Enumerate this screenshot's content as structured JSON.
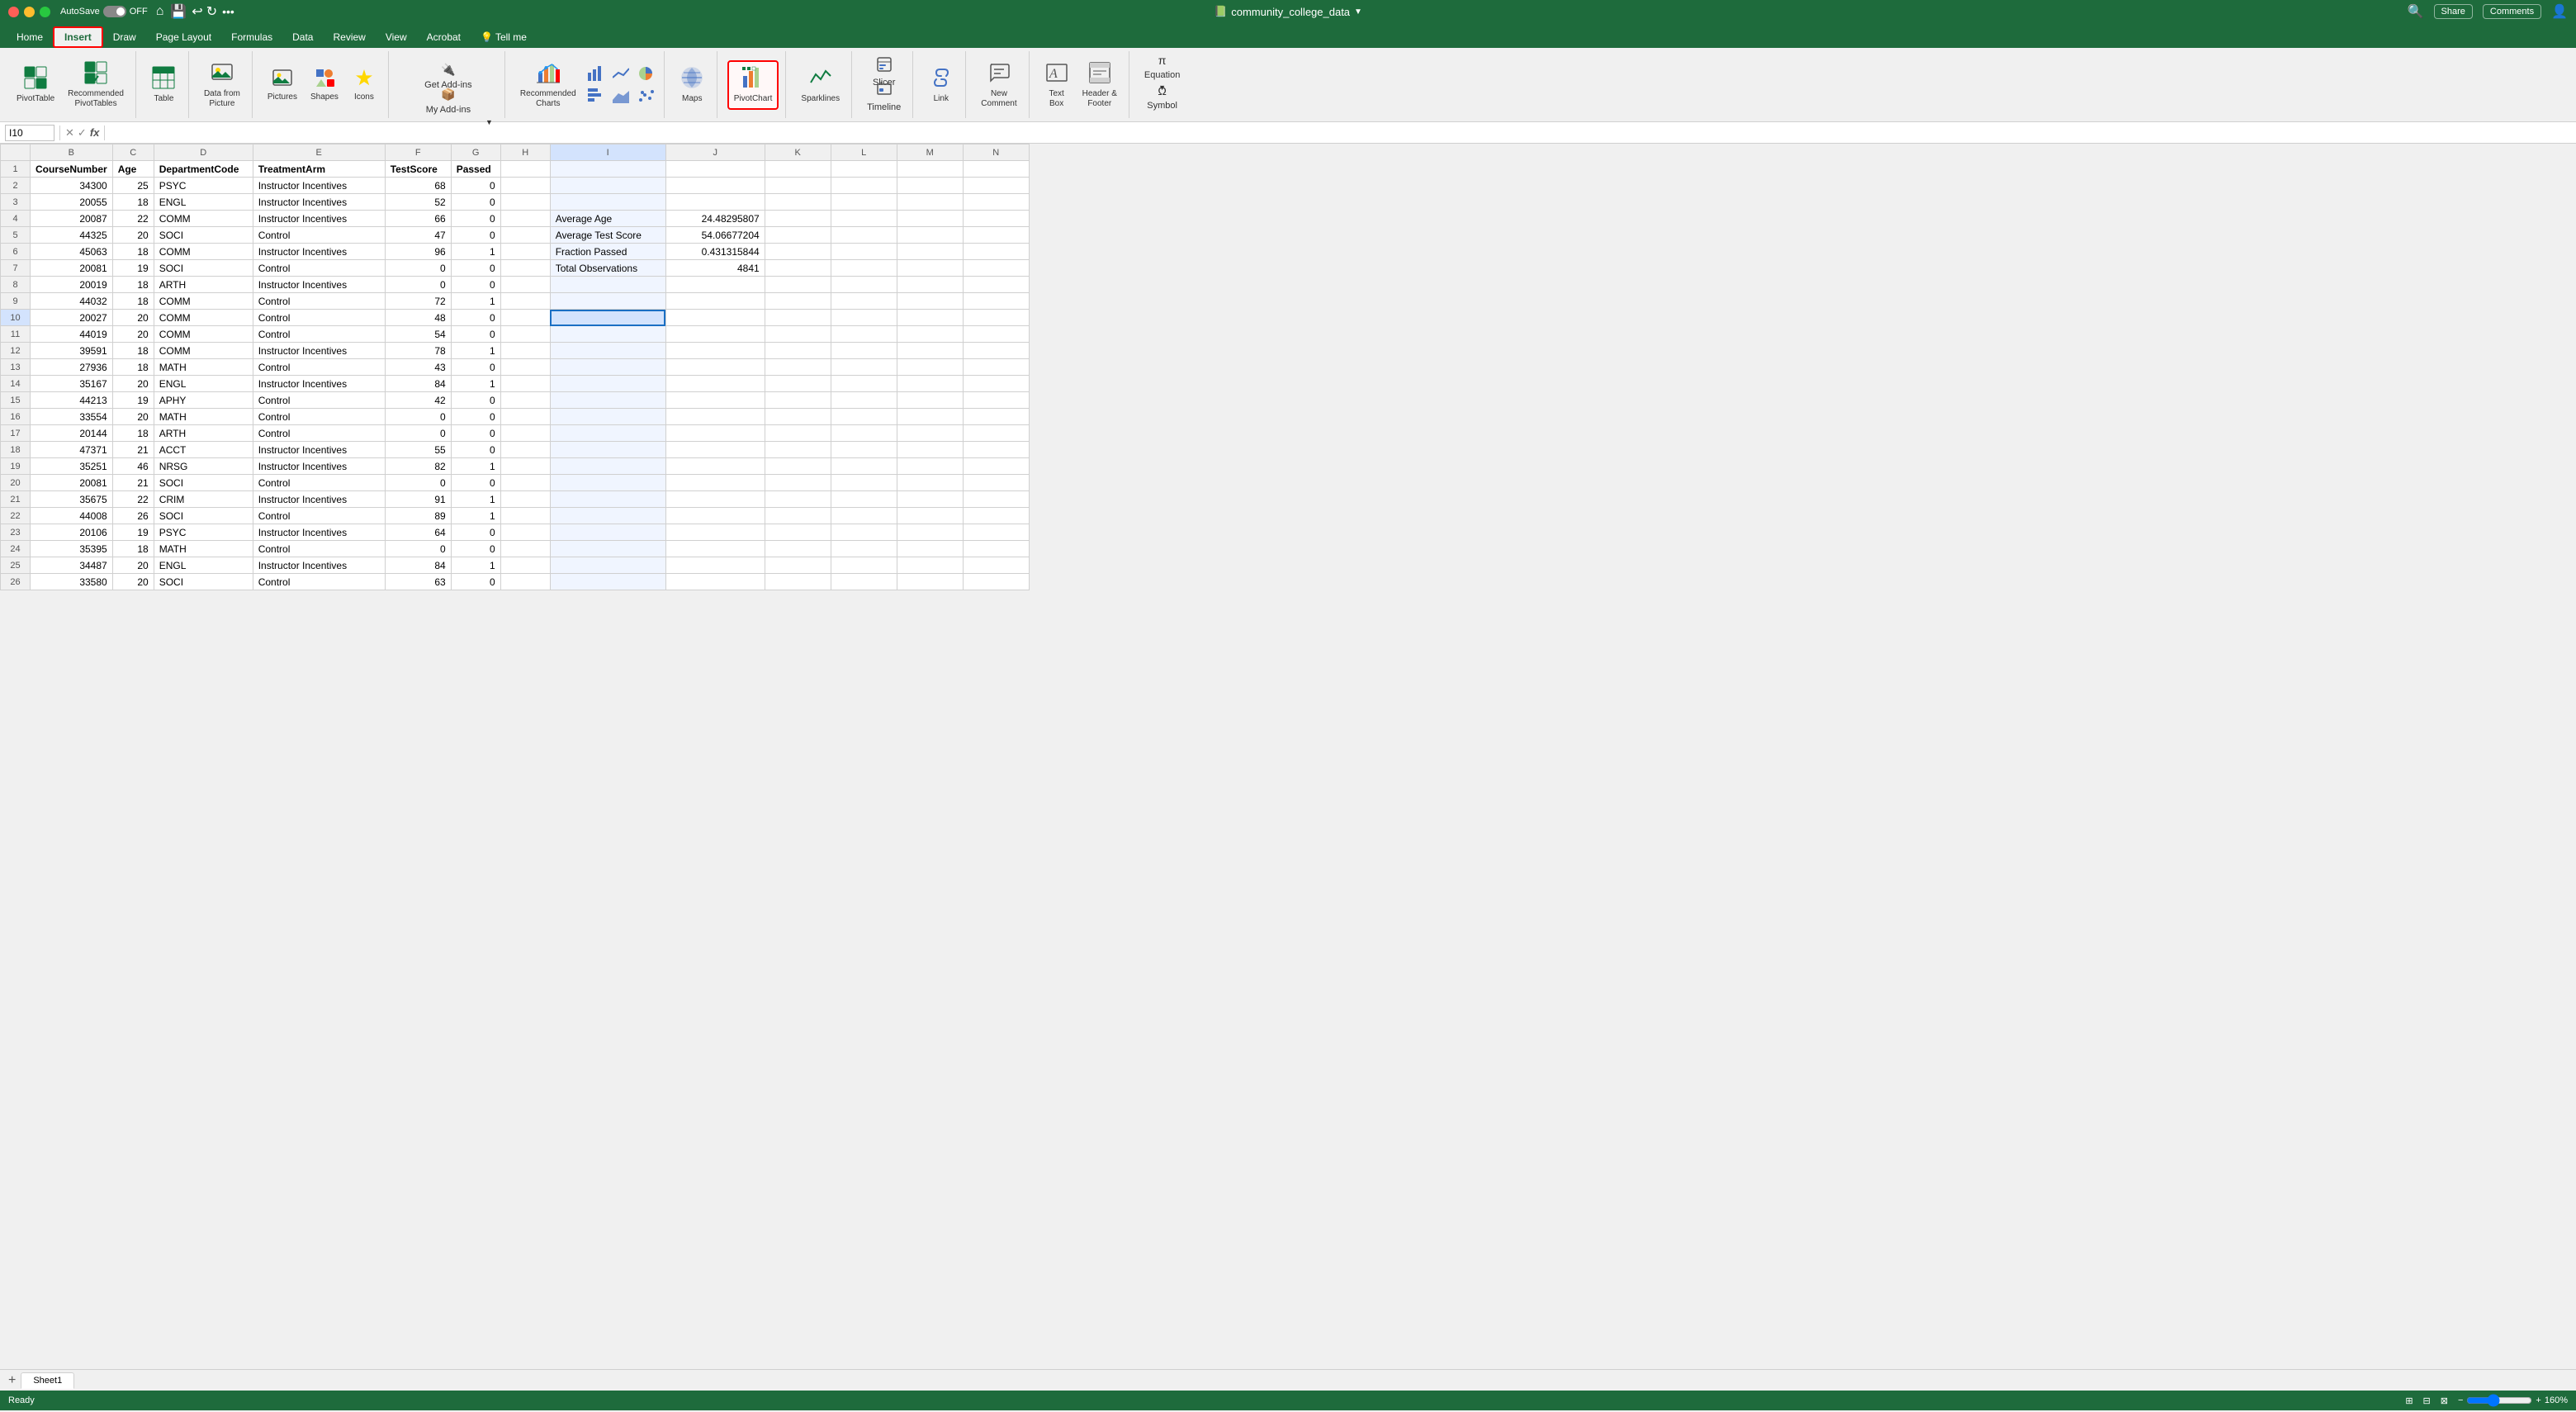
{
  "titleBar": {
    "filename": "community_college_data",
    "windowControls": [
      "close",
      "minimize",
      "maximize"
    ],
    "rightIcons": [
      "search",
      "share",
      "more"
    ]
  },
  "tabs": [
    {
      "label": "Home",
      "active": false
    },
    {
      "label": "Insert",
      "active": true
    },
    {
      "label": "Draw",
      "active": false
    },
    {
      "label": "Page Layout",
      "active": false
    },
    {
      "label": "Formulas",
      "active": false
    },
    {
      "label": "Data",
      "active": false
    },
    {
      "label": "Review",
      "active": false
    },
    {
      "label": "View",
      "active": false
    },
    {
      "label": "Acrobat",
      "active": false
    },
    {
      "label": "Tell me",
      "active": false
    }
  ],
  "ribbon": {
    "groups": [
      {
        "label": "",
        "items": [
          {
            "id": "pivot-table",
            "icon": "📊",
            "label": "PivotTable",
            "highlighted": false
          },
          {
            "id": "recommended-pivottables",
            "icon": "📋",
            "label": "Recommended\nPivotTables",
            "highlighted": false
          }
        ]
      },
      {
        "label": "",
        "items": [
          {
            "id": "table",
            "icon": "⊞",
            "label": "Table",
            "highlighted": false
          }
        ]
      },
      {
        "label": "",
        "items": [
          {
            "id": "data-from-picture",
            "icon": "🖼",
            "label": "Data from\nPicture",
            "highlighted": false
          }
        ]
      },
      {
        "label": "",
        "items": [
          {
            "id": "pictures",
            "icon": "🖼",
            "label": "Pictures",
            "highlighted": false
          },
          {
            "id": "shapes",
            "icon": "⬡",
            "label": "Shapes",
            "highlighted": false
          },
          {
            "id": "icons",
            "icon": "⭐",
            "label": "Icons",
            "highlighted": false
          }
        ]
      },
      {
        "label": "",
        "items": [
          {
            "id": "get-addins",
            "icon": "🔌",
            "label": "Get Add-ins",
            "highlighted": false
          },
          {
            "id": "my-addins",
            "icon": "📦",
            "label": "My Add-ins",
            "highlighted": false
          }
        ]
      },
      {
        "label": "",
        "items": [
          {
            "id": "recommended-charts",
            "icon": "📈",
            "label": "Recommended\nCharts",
            "highlighted": false
          },
          {
            "id": "insert-column-chart",
            "icon": "📊",
            "label": "",
            "highlighted": false
          },
          {
            "id": "insert-line-chart",
            "icon": "📉",
            "label": "",
            "highlighted": false
          },
          {
            "id": "insert-pie-chart",
            "icon": "🥧",
            "label": "",
            "highlighted": false
          },
          {
            "id": "insert-bar-chart",
            "icon": "▬",
            "label": "",
            "highlighted": false
          },
          {
            "id": "insert-area-chart",
            "icon": "△",
            "label": "",
            "highlighted": false
          },
          {
            "id": "insert-scatter",
            "icon": "⋯",
            "label": "",
            "highlighted": false
          },
          {
            "id": "insert-other-charts",
            "icon": "…",
            "label": "",
            "highlighted": false
          }
        ]
      },
      {
        "label": "",
        "items": [
          {
            "id": "maps",
            "icon": "🗺",
            "label": "Maps",
            "highlighted": false
          }
        ]
      },
      {
        "label": "",
        "items": [
          {
            "id": "pivot-chart",
            "icon": "📊",
            "label": "PivotChart",
            "highlighted": true
          }
        ]
      },
      {
        "label": "",
        "items": [
          {
            "id": "sparklines",
            "icon": "〰",
            "label": "Sparklines",
            "highlighted": false
          }
        ]
      },
      {
        "label": "",
        "items": [
          {
            "id": "slicer",
            "icon": "🔲",
            "label": "Slicer",
            "highlighted": false
          },
          {
            "id": "timeline",
            "icon": "📅",
            "label": "Timeline",
            "highlighted": false
          }
        ]
      },
      {
        "label": "",
        "items": [
          {
            "id": "link",
            "icon": "🔗",
            "label": "Link",
            "highlighted": false
          }
        ]
      },
      {
        "label": "",
        "items": [
          {
            "id": "new-comment",
            "icon": "💬",
            "label": "New\nComment",
            "highlighted": false
          }
        ]
      },
      {
        "label": "",
        "items": [
          {
            "id": "text-box",
            "icon": "𝐴",
            "label": "Text\nBox",
            "highlighted": false
          },
          {
            "id": "header-footer",
            "icon": "≡",
            "label": "Header &\nFooter",
            "highlighted": false
          }
        ]
      },
      {
        "label": "",
        "items": [
          {
            "id": "equation",
            "icon": "Ω",
            "label": "Equation",
            "highlighted": false
          },
          {
            "id": "symbol",
            "icon": "§",
            "label": "Symbol",
            "highlighted": false
          }
        ]
      }
    ]
  },
  "formulaBar": {
    "cellRef": "I10",
    "formula": ""
  },
  "columns": [
    {
      "label": "",
      "width": 36
    },
    {
      "label": "B",
      "width": 80
    },
    {
      "label": "C",
      "width": 50
    },
    {
      "label": "D",
      "width": 120
    },
    {
      "label": "E",
      "width": 160
    },
    {
      "label": "F",
      "width": 80
    },
    {
      "label": "G",
      "width": 60
    },
    {
      "label": "H",
      "width": 60
    },
    {
      "label": "I",
      "width": 140
    },
    {
      "label": "J",
      "width": 120
    },
    {
      "label": "K",
      "width": 80
    },
    {
      "label": "L",
      "width": 80
    },
    {
      "label": "M",
      "width": 80
    },
    {
      "label": "N",
      "width": 80
    }
  ],
  "headers": [
    "CourseNumber",
    "Age",
    "DepartmentCode",
    "TreatmentArm",
    "TestScore",
    "Passed",
    "",
    "",
    "",
    "",
    "",
    "",
    ""
  ],
  "rows": [
    {
      "num": 2,
      "B": "34300",
      "C": "25",
      "D": "PSYC",
      "E": "Instructor Incentives",
      "F": "68",
      "G": "0",
      "H": "",
      "I": "",
      "J": "",
      "K": "",
      "L": "",
      "M": "",
      "N": ""
    },
    {
      "num": 3,
      "B": "20055",
      "C": "18",
      "D": "ENGL",
      "E": "Instructor Incentives",
      "F": "52",
      "G": "0",
      "H": "",
      "I": "",
      "J": "",
      "K": "",
      "L": "",
      "M": "",
      "N": ""
    },
    {
      "num": 4,
      "B": "20087",
      "C": "22",
      "D": "COMM",
      "E": "Instructor Incentives",
      "F": "66",
      "G": "0",
      "H": "",
      "I": "Average Age",
      "J": "24.48295807",
      "K": "",
      "L": "",
      "M": "",
      "N": ""
    },
    {
      "num": 5,
      "B": "44325",
      "C": "20",
      "D": "SOCI",
      "E": "Control",
      "F": "47",
      "G": "0",
      "H": "",
      "I": "Average Test Score",
      "J": "54.06677204",
      "K": "",
      "L": "",
      "M": "",
      "N": ""
    },
    {
      "num": 6,
      "B": "45063",
      "C": "18",
      "D": "COMM",
      "E": "Instructor Incentives",
      "F": "96",
      "G": "1",
      "H": "",
      "I": "Fraction Passed",
      "J": "0.431315844",
      "K": "",
      "L": "",
      "M": "",
      "N": ""
    },
    {
      "num": 7,
      "B": "20081",
      "C": "19",
      "D": "SOCI",
      "E": "Control",
      "F": "0",
      "G": "0",
      "H": "",
      "I": "Total Observations",
      "J": "4841",
      "K": "",
      "L": "",
      "M": "",
      "N": ""
    },
    {
      "num": 8,
      "B": "20019",
      "C": "18",
      "D": "ARTH",
      "E": "Instructor Incentives",
      "F": "0",
      "G": "0",
      "H": "",
      "I": "",
      "J": "",
      "K": "",
      "L": "",
      "M": "",
      "N": ""
    },
    {
      "num": 9,
      "B": "44032",
      "C": "18",
      "D": "COMM",
      "E": "Control",
      "F": "72",
      "G": "1",
      "H": "",
      "I": "",
      "J": "",
      "K": "",
      "L": "",
      "M": "",
      "N": ""
    },
    {
      "num": 10,
      "B": "20027",
      "C": "20",
      "D": "COMM",
      "E": "Control",
      "F": "48",
      "G": "0",
      "H": "",
      "I": "[SELECTED]",
      "J": "",
      "K": "",
      "L": "",
      "M": "",
      "N": ""
    },
    {
      "num": 11,
      "B": "44019",
      "C": "20",
      "D": "COMM",
      "E": "Control",
      "F": "54",
      "G": "0",
      "H": "",
      "I": "",
      "J": "",
      "K": "",
      "L": "",
      "M": "",
      "N": ""
    },
    {
      "num": 12,
      "B": "39591",
      "C": "18",
      "D": "COMM",
      "E": "Instructor Incentives",
      "F": "78",
      "G": "1",
      "H": "",
      "I": "",
      "J": "",
      "K": "",
      "L": "",
      "M": "",
      "N": ""
    },
    {
      "num": 13,
      "B": "27936",
      "C": "18",
      "D": "MATH",
      "E": "Control",
      "F": "43",
      "G": "0",
      "H": "",
      "I": "",
      "J": "",
      "K": "",
      "L": "",
      "M": "",
      "N": ""
    },
    {
      "num": 14,
      "B": "35167",
      "C": "20",
      "D": "ENGL",
      "E": "Instructor Incentives",
      "F": "84",
      "G": "1",
      "H": "",
      "I": "",
      "J": "",
      "K": "",
      "L": "",
      "M": "",
      "N": ""
    },
    {
      "num": 15,
      "B": "44213",
      "C": "19",
      "D": "APHY",
      "E": "Control",
      "F": "42",
      "G": "0",
      "H": "",
      "I": "",
      "J": "",
      "K": "",
      "L": "",
      "M": "",
      "N": ""
    },
    {
      "num": 16,
      "B": "33554",
      "C": "20",
      "D": "MATH",
      "E": "Control",
      "F": "0",
      "G": "0",
      "H": "",
      "I": "",
      "J": "",
      "K": "",
      "L": "",
      "M": "",
      "N": ""
    },
    {
      "num": 17,
      "B": "20144",
      "C": "18",
      "D": "ARTH",
      "E": "Control",
      "F": "0",
      "G": "0",
      "H": "",
      "I": "",
      "J": "",
      "K": "",
      "L": "",
      "M": "",
      "N": ""
    },
    {
      "num": 18,
      "B": "47371",
      "C": "21",
      "D": "ACCT",
      "E": "Instructor Incentives",
      "F": "55",
      "G": "0",
      "H": "",
      "I": "",
      "J": "",
      "K": "",
      "L": "",
      "M": "",
      "N": ""
    },
    {
      "num": 19,
      "B": "35251",
      "C": "46",
      "D": "NRSG",
      "E": "Instructor Incentives",
      "F": "82",
      "G": "1",
      "H": "",
      "I": "",
      "J": "",
      "K": "",
      "L": "",
      "M": "",
      "N": ""
    },
    {
      "num": 20,
      "B": "20081",
      "C": "21",
      "D": "SOCI",
      "E": "Control",
      "F": "0",
      "G": "0",
      "H": "",
      "I": "",
      "J": "",
      "K": "",
      "L": "",
      "M": "",
      "N": ""
    },
    {
      "num": 21,
      "B": "35675",
      "C": "22",
      "D": "CRIM",
      "E": "Instructor Incentives",
      "F": "91",
      "G": "1",
      "H": "",
      "I": "",
      "J": "",
      "K": "",
      "L": "",
      "M": "",
      "N": ""
    },
    {
      "num": 22,
      "B": "44008",
      "C": "26",
      "D": "SOCI",
      "E": "Control",
      "F": "89",
      "G": "1",
      "H": "",
      "I": "",
      "J": "",
      "K": "",
      "L": "",
      "M": "",
      "N": ""
    },
    {
      "num": 23,
      "B": "20106",
      "C": "19",
      "D": "PSYC",
      "E": "Instructor Incentives",
      "F": "64",
      "G": "0",
      "H": "",
      "I": "",
      "J": "",
      "K": "",
      "L": "",
      "M": "",
      "N": ""
    },
    {
      "num": 24,
      "B": "35395",
      "C": "18",
      "D": "MATH",
      "E": "Control",
      "F": "0",
      "G": "0",
      "H": "",
      "I": "",
      "J": "",
      "K": "",
      "L": "",
      "M": "",
      "N": ""
    },
    {
      "num": 25,
      "B": "34487",
      "C": "20",
      "D": "ENGL",
      "E": "Instructor Incentives",
      "F": "84",
      "G": "1",
      "H": "",
      "I": "",
      "J": "",
      "K": "",
      "L": "",
      "M": "",
      "N": ""
    },
    {
      "num": 26,
      "B": "33580",
      "C": "20",
      "D": "SOCI",
      "E": "Control",
      "F": "63",
      "G": "0",
      "H": "",
      "I": "",
      "J": "",
      "K": "",
      "L": "",
      "M": "",
      "N": ""
    }
  ],
  "sheetTabs": [
    "Sheet1"
  ],
  "statusBar": {
    "status": "Ready",
    "zoom": "160%"
  },
  "autosave": {
    "label": "AutoSave",
    "state": "OFF"
  },
  "shareBtn": "Share",
  "commentsBtn": "Comments",
  "insertTabHighlight": true,
  "pivotChartHighlight": true
}
